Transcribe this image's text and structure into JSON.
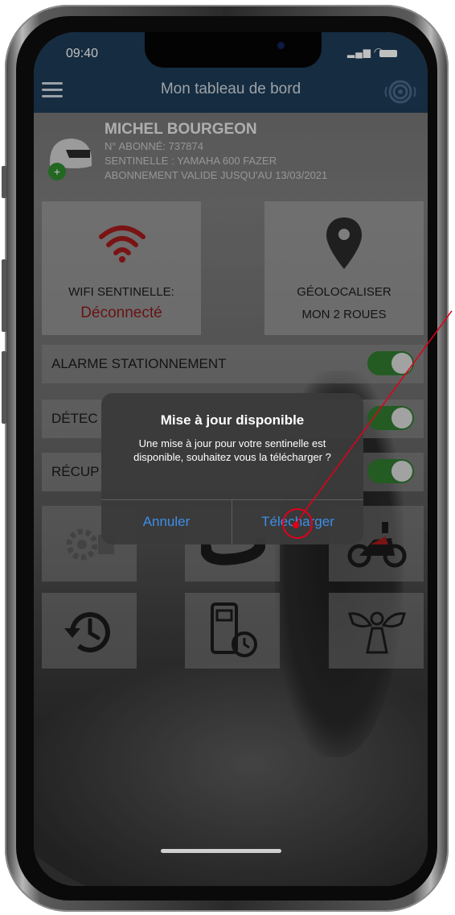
{
  "status_bar": {
    "time": "09:40"
  },
  "header": {
    "title": "Mon tableau de bord",
    "menu_icon": "hamburger-menu-icon",
    "radar_icon": "radar-icon"
  },
  "profile": {
    "name": "MICHEL BOURGEON",
    "subscriber": "N° ABONNÉ: 737874",
    "sentinel": "SENTINELLE : YAMAHA 600 FAZER",
    "subscription": "ABONNEMENT VALIDE JUSQU'AU 13/03/2021",
    "add_icon": "+"
  },
  "tiles": {
    "wifi": {
      "label": "WIFI SENTINELLE:",
      "status": "Déconnecté",
      "color": "#a31b1b"
    },
    "geo": {
      "line1": "GÉOLOCALISER",
      "line2": "MON 2 ROUES"
    }
  },
  "toggles": [
    {
      "label": "ALARME STATIONNEMENT",
      "on": true
    },
    {
      "label": "DÉTEC",
      "on": true
    },
    {
      "label": "RÉCUP",
      "on": true
    }
  ],
  "dialog": {
    "title": "Mise à jour disponible",
    "message": "Une mise à jour pour votre sentinelle est disponible, souhaitez vous la télécharger ?",
    "cancel": "Annuler",
    "confirm": "Télécharger"
  },
  "colors": {
    "header": "#1d3b57",
    "toggle_on": "#2f7a2f",
    "dialog_button": "#3d8ee8",
    "annotation": "#e0001b"
  }
}
